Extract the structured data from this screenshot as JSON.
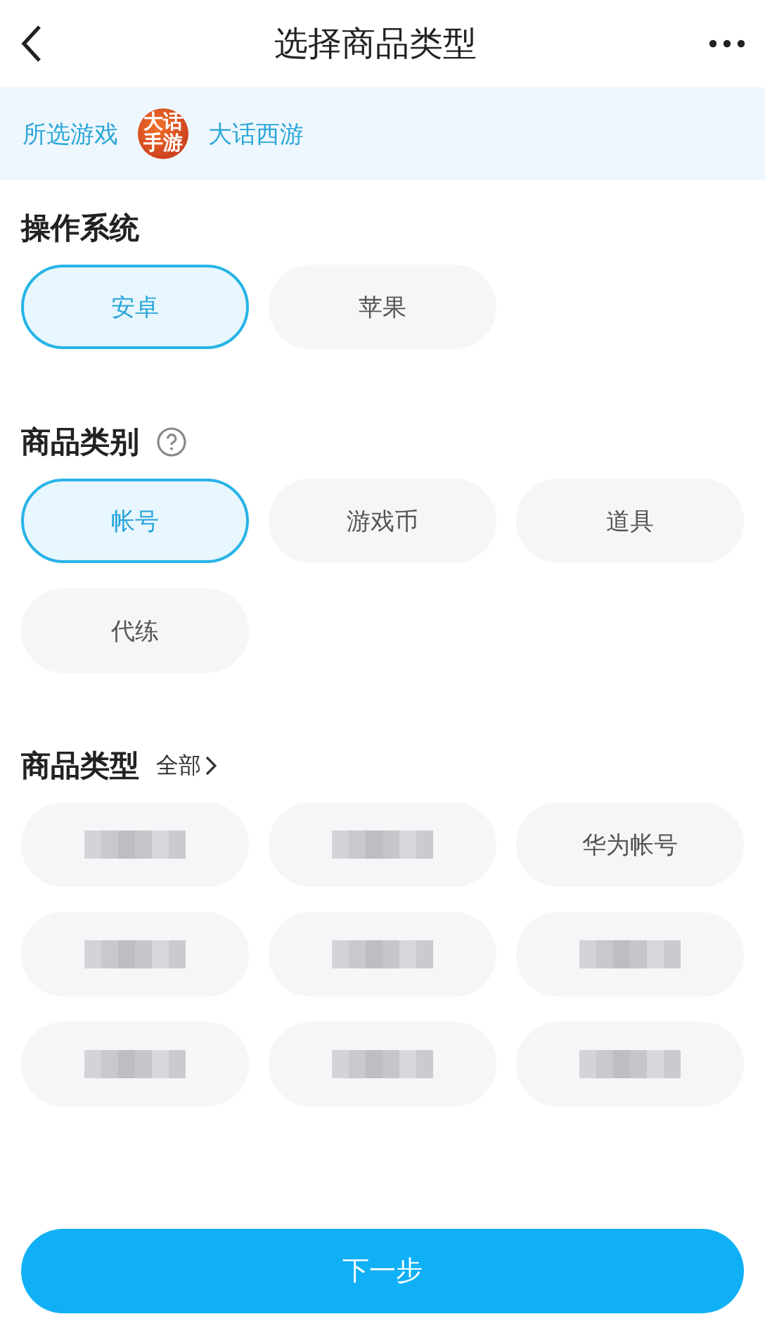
{
  "header": {
    "title": "选择商品类型"
  },
  "game": {
    "label": "所选游戏",
    "logo_text": "大话手游",
    "name": "大话西游"
  },
  "sections": [
    {
      "title": "操作系统",
      "options": [
        {
          "kind": "text",
          "label": "安卓",
          "selected": true
        },
        {
          "kind": "text",
          "label": "苹果",
          "selected": false
        }
      ]
    },
    {
      "title": "商品类别",
      "help": true,
      "options": [
        {
          "kind": "text",
          "label": "帐号",
          "selected": true
        },
        {
          "kind": "text",
          "label": "游戏币",
          "selected": false
        },
        {
          "kind": "text",
          "label": "道具",
          "selected": false
        },
        {
          "kind": "text",
          "label": "代练",
          "selected": false
        }
      ]
    },
    {
      "title": "商品类型",
      "link": "全部",
      "options": [
        {
          "kind": "blurred",
          "selected": false
        },
        {
          "kind": "blurred",
          "selected": false
        },
        {
          "kind": "text",
          "label": "华为帐号",
          "selected": false
        },
        {
          "kind": "blurred",
          "selected": false
        },
        {
          "kind": "blurred",
          "selected": false
        },
        {
          "kind": "blurred",
          "selected": false
        },
        {
          "kind": "blurred",
          "selected": false
        },
        {
          "kind": "blurred",
          "selected": false
        },
        {
          "kind": "blurred",
          "selected": false
        }
      ]
    }
  ],
  "next_button": "下一步"
}
